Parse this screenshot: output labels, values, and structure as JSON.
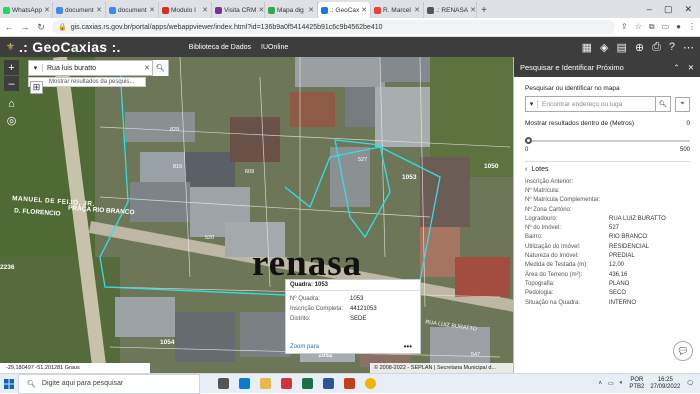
{
  "browser": {
    "tabs": [
      {
        "label": "WhatsApp",
        "color": "#25d366"
      },
      {
        "label": "document",
        "color": "#4285f4"
      },
      {
        "label": "document",
        "color": "#4285f4"
      },
      {
        "label": "Modulo I",
        "color": "#d93025"
      },
      {
        "label": "Visita CRM",
        "color": "#7b2f9e"
      },
      {
        "label": "Mapa dig",
        "color": "#34a853"
      },
      {
        "label": ".: GeoCax",
        "color": "#1a73e8",
        "active": true
      },
      {
        "label": "R. Marcel",
        "color": "#ea4335"
      },
      {
        "label": ".: RENASA",
        "color": "#555555"
      }
    ],
    "new_tab": "+",
    "url": "gis.caxias.rs.gov.br/portal/apps/webappviewer/index.html?id=136b9a0f5414425b91c6c9b4562be410"
  },
  "app": {
    "title": ".: GeoCaxias :.",
    "links": [
      "Biblioteca de Dados",
      "IUOnline"
    ]
  },
  "search": {
    "value": "Rua luis buratto",
    "results_hint": "Mostrar resultados da pesquis..."
  },
  "map": {
    "labels": {
      "street1": "D. FLORENCIO",
      "street2": "MANUEL DE FEIJÓ, JR.",
      "street3": "PRAÇA RIO BRANCO",
      "street4": "RUA LUIZ BURATTO",
      "q1054": "1054",
      "q1052": "1052",
      "q1053": "1053",
      "q2236": "2236",
      "q1050": "1050",
      "lot1": "829",
      "lot2": "816",
      "lot3": "527",
      "lot4": "609",
      "lot5": "520",
      "lot6": "541",
      "lot7": "591",
      "lot8": "547"
    },
    "coords": "-29,180497 -51,201281 Graus",
    "copyright": "© 2008-2022 - SEPLAN | Secretaria Municipal d..."
  },
  "popup": {
    "title": "Quadra: 1053",
    "rows": [
      {
        "k": "Nº Quadra:",
        "v": "1053"
      },
      {
        "k": "Inscrição Completa:",
        "v": "44121053"
      },
      {
        "k": "Distrito:",
        "v": "SEDE"
      }
    ],
    "zoom": "Zoom para",
    "more": "•••"
  },
  "watermark": "renasa",
  "panel": {
    "title": "Pesquisar e Identificar Próximo",
    "search_label": "Pesquisar ou identificar no mapa",
    "address_placeholder": "Encontrar endereço ou luga",
    "distance_label": "Mostrar resultados dentro de (Metros)",
    "distance_value": "0",
    "slider_min": "0",
    "slider_max": "500",
    "slider_level": 0,
    "back_label": "Lotes",
    "attributes": [
      {
        "k": "Inscrição Anterior:",
        "v": ""
      },
      {
        "k": "Nº Matrícula:",
        "v": ""
      },
      {
        "k": "Nº Matrícula Complementar:",
        "v": ""
      },
      {
        "k": "Nº Zona Cartório:",
        "v": ""
      },
      {
        "k": "Logradouro:",
        "v": "RUA LUIZ BURATTO"
      },
      {
        "k": "Nº do Imóvel:",
        "v": "527"
      },
      {
        "k": "Bairro:",
        "v": "RIO BRANCO"
      },
      {
        "k": "Utilização do Imóvel:",
        "v": "RESIDENCIAL"
      },
      {
        "k": "Natureza do Imóvel:",
        "v": "PREDIAL"
      },
      {
        "k": "Medida de Testada (m):",
        "v": "12,00"
      },
      {
        "k": "Área do Terreno (m²):",
        "v": "436,16"
      },
      {
        "k": "Topografia:",
        "v": "PLANO"
      },
      {
        "k": "Pedologia:",
        "v": "SECO"
      },
      {
        "k": "Situação na Quadra:",
        "v": "INTERNO"
      }
    ]
  },
  "taskbar": {
    "search_placeholder": "Digite aqui para pesquisar",
    "lang1": "POR",
    "lang2": "PTB2",
    "time": "16:25",
    "date": "27/09/2022"
  }
}
